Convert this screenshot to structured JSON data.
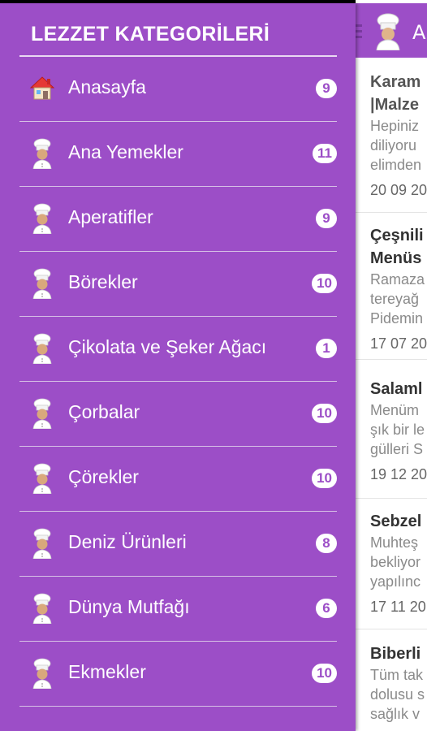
{
  "drawer": {
    "title": "LEZZET KATEGORİLERİ",
    "items": [
      {
        "label": "Anasayfa",
        "count": "9",
        "icon": "house-icon"
      },
      {
        "label": "Ana Yemekler",
        "count": "11",
        "icon": "chef-icon"
      },
      {
        "label": "Aperatifler",
        "count": "9",
        "icon": "chef-icon"
      },
      {
        "label": "Börekler",
        "count": "10",
        "icon": "chef-icon"
      },
      {
        "label": "Çikolata ve Şeker Ağacı",
        "count": "1",
        "icon": "chef-icon"
      },
      {
        "label": "Çorbalar",
        "count": "10",
        "icon": "chef-icon"
      },
      {
        "label": "Çörekler",
        "count": "10",
        "icon": "chef-icon"
      },
      {
        "label": "Deniz Ürünleri",
        "count": "8",
        "icon": "chef-icon"
      },
      {
        "label": "Dünya Mutfağı",
        "count": "6",
        "icon": "chef-icon"
      },
      {
        "label": "Ekmekler",
        "count": "10",
        "icon": "chef-icon"
      }
    ]
  },
  "main": {
    "header_title": "A",
    "articles": [
      {
        "title1": "Karam",
        "title2": "|Malze",
        "e1": "Hepiniz",
        "e2": "diliyoru",
        "e3": "elimden",
        "date": "20 09 20"
      },
      {
        "title1": "Çeşnili",
        "title2": "Menüs",
        "e1": "Ramaza",
        "e2": "tereyağ",
        "e3": "Pidemin",
        "date": "17 07 20"
      },
      {
        "title1": "Salaml",
        "e1": "Menüm",
        "e2": "şık bir le",
        "e3": "gülleri S",
        "date": "19 12 20"
      },
      {
        "title1": "Sebzel",
        "e1": "Muhteş",
        "e2": "bekliyor",
        "e3": "yapılınc",
        "date": "17 11 20"
      },
      {
        "title1": "Biberli",
        "e1": "Tüm tak",
        "e2": "dolusu s",
        "e3": "sağlık v"
      }
    ]
  },
  "colors": {
    "accent": "#9C4EC7",
    "divider": "#d7c1e6"
  }
}
